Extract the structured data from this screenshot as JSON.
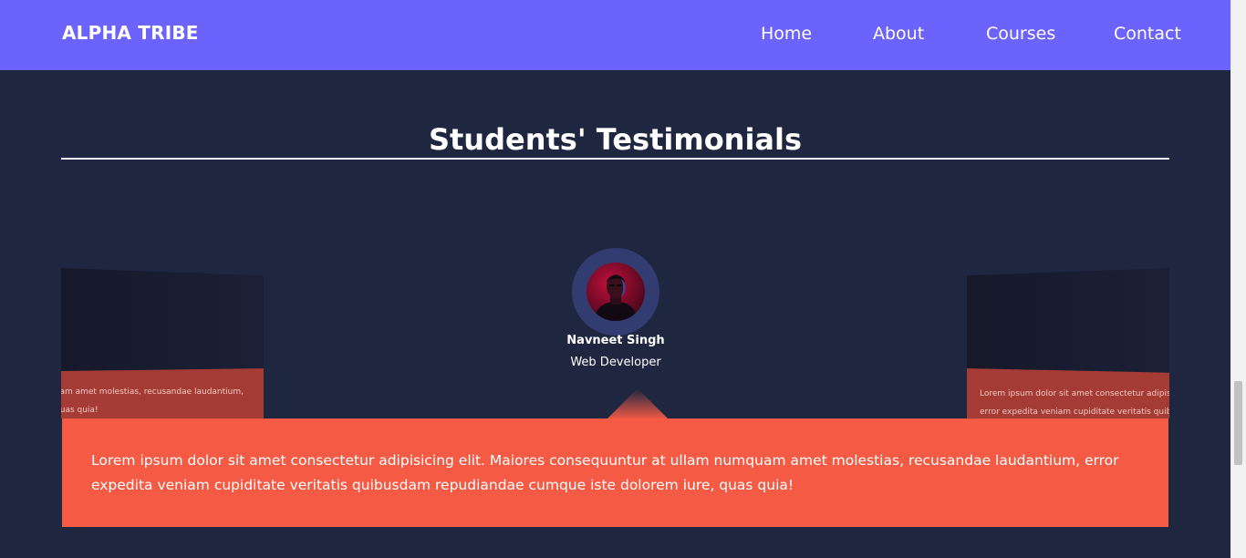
{
  "navbar": {
    "brand": "ALPHA TRIBE",
    "links": [
      "Home",
      "About",
      "Courses",
      "Contact"
    ],
    "background": "#6c63ff"
  },
  "section": {
    "title": "Students' Testimonials"
  },
  "testimonial": {
    "name": "Navneet Singh",
    "role": "Web Developer",
    "quote": "Lorem ipsum dolor sit amet consectetur adipisicing elit. Maiores consequuntur at ullam numquam amet molestias, recusandae laudantium, error expedita veniam cupiditate veritatis quibusdam repudiandae cumque iste dolorem iure, quas quia!",
    "accent": "#f55a44"
  },
  "side_cards": {
    "left": {
      "line1": "umquam amet molestias, recusandae laudantium,",
      "line2": "ure, quas quia!"
    },
    "right": {
      "line1": "Lorem ipsum dolor sit amet consectetur adipisicing e",
      "line2": "error expedita veniam cupiditate veritatis quibusdam"
    }
  },
  "colors": {
    "page_background": "#1f2640",
    "avatar_ring": "#323c70"
  }
}
